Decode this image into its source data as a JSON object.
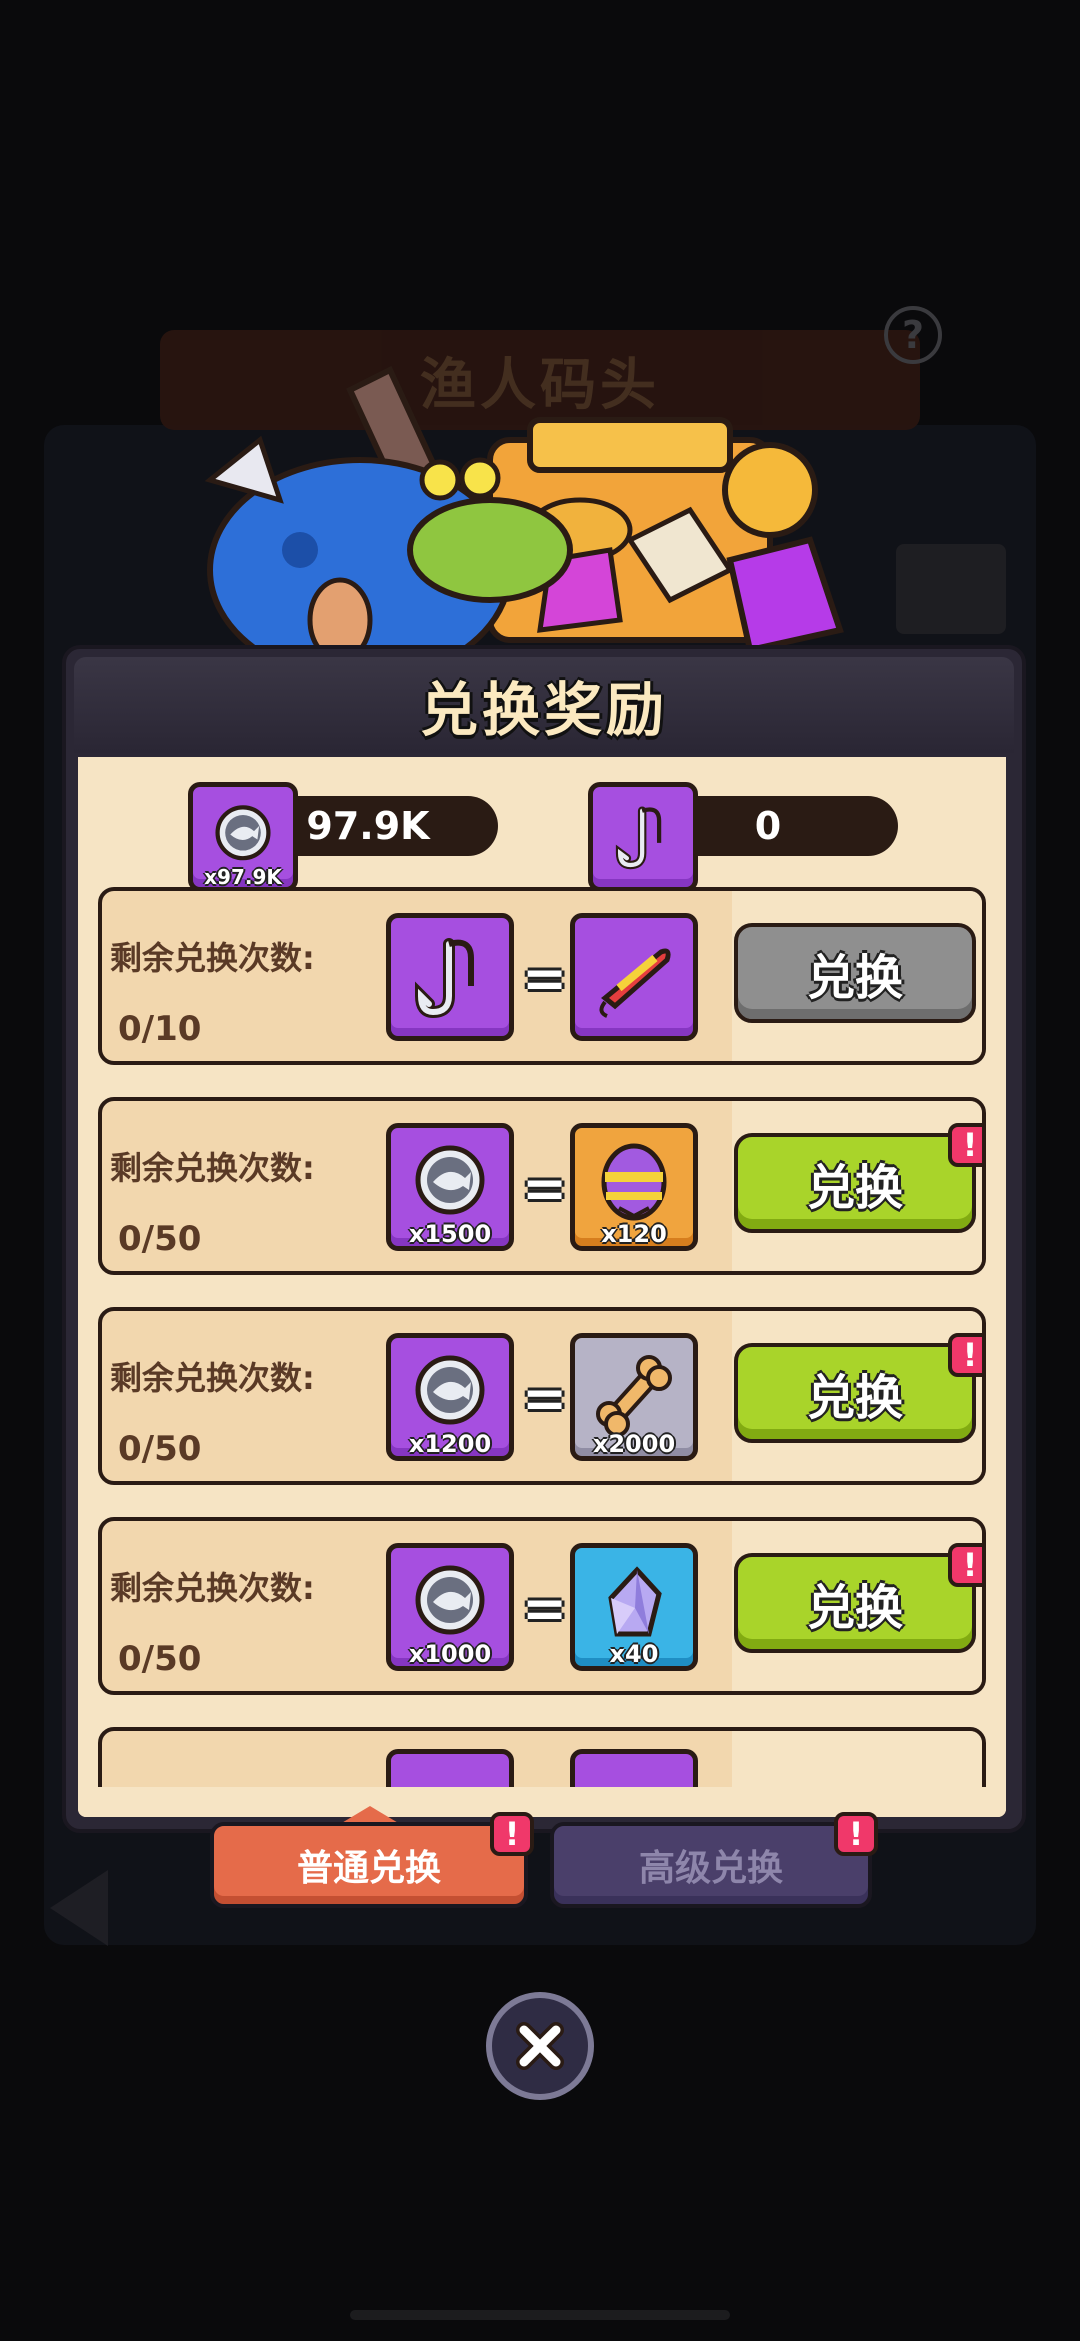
{
  "background": {
    "title": "渔人码头",
    "help_symbol": "?"
  },
  "dialog": {
    "title": "兑换奖励",
    "currencies": [
      {
        "icon": "fish-coin-icon",
        "amount": "97.9K",
        "badge_qty": "x97.9K"
      },
      {
        "icon": "fishing-hook-icon",
        "amount": "0"
      }
    ],
    "rows": [
      {
        "label": "剩余兑换次数:",
        "count": "0/10",
        "cost_icon": "fishing-hook-icon",
        "cost_qty": "",
        "equals": "=",
        "reward_icon": "fishing-lure-icon",
        "reward_qty": "",
        "button": "兑换",
        "button_state": "disabled",
        "alert": false
      },
      {
        "label": "剩余兑换次数:",
        "count": "0/50",
        "cost_icon": "fish-coin-icon",
        "cost_qty": "x1500",
        "equals": "=",
        "reward_icon": "striped-egg-icon",
        "reward_qty": "x120",
        "button": "兑换",
        "button_state": "enabled",
        "alert": true
      },
      {
        "label": "剩余兑换次数:",
        "count": "0/50",
        "cost_icon": "fish-coin-icon",
        "cost_qty": "x1200",
        "equals": "=",
        "reward_icon": "bone-icon",
        "reward_qty": "x2000",
        "button": "兑换",
        "button_state": "enabled",
        "alert": true
      },
      {
        "label": "剩余兑换次数:",
        "count": "0/50",
        "cost_icon": "fish-coin-icon",
        "cost_qty": "x1000",
        "equals": "=",
        "reward_icon": "crystal-icon",
        "reward_qty": "x40",
        "button": "兑换",
        "button_state": "enabled",
        "alert": true
      }
    ],
    "alert_symbol": "!"
  },
  "tabs": [
    {
      "label": "普通兑换",
      "active": true,
      "alert": true
    },
    {
      "label": "高级兑换",
      "active": false,
      "alert": true
    }
  ],
  "colors": {
    "accent_green": "#a9d42a",
    "disabled_grey": "#8f8f8f",
    "item_purple": "#a64fe0",
    "alert_pink": "#f0386a",
    "active_tab": "#e56b4a",
    "inactive_tab": "#4a3f6a"
  }
}
